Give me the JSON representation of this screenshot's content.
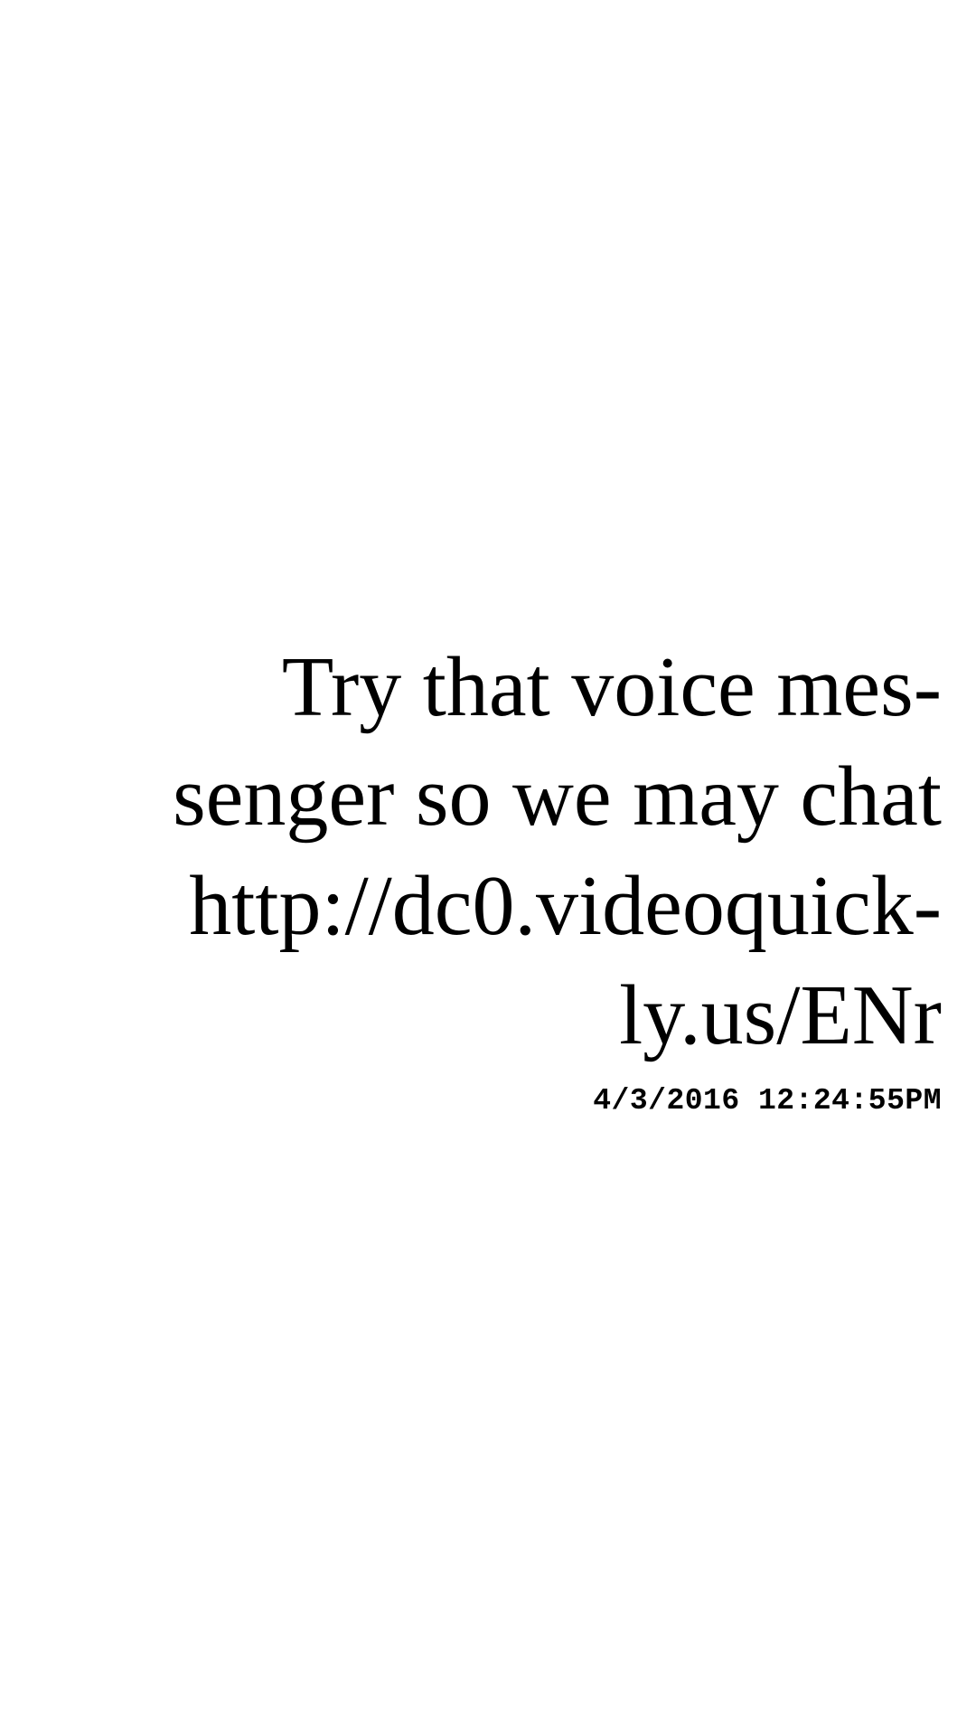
{
  "message": {
    "lines": [
      "Try that voice mes-",
      "senger so we may chat",
      "http://dc0.videoquick-",
      "ly.us/ENr"
    ],
    "timestamp": "4/3/2016 12:24:55PM"
  },
  "colors": {
    "background": "#ffffff",
    "text": "#000000"
  }
}
